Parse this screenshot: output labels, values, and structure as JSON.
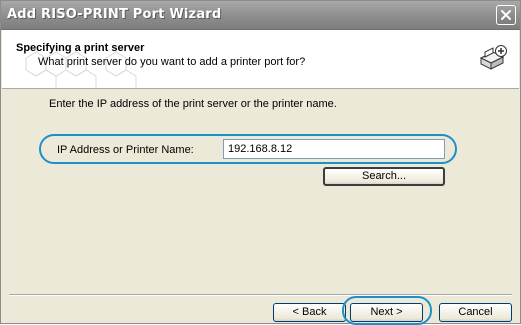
{
  "window": {
    "title": "Add RISO-PRINT Port Wizard"
  },
  "header": {
    "title": "Specifying a print server",
    "subtitle": "What print server do you want to add a printer port for?",
    "icon": "printer-add-icon"
  },
  "body": {
    "instruction": "Enter the IP address of the print server or the printer name.",
    "field_label": "IP Address or Printer Name:",
    "field_value": "192.168.8.12",
    "search_label": "Search..."
  },
  "footer": {
    "back_label": "< Back",
    "next_label": "Next >",
    "cancel_label": "Cancel"
  },
  "colors": {
    "highlight": "#1e90c8",
    "titlebar": "#8f8f8f"
  }
}
